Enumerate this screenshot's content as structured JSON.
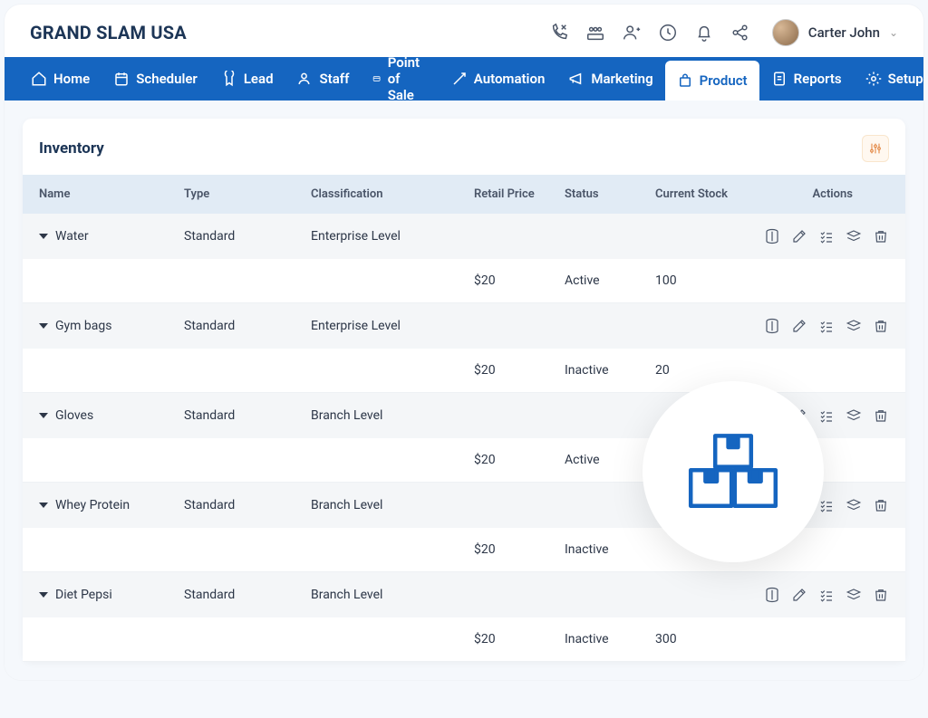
{
  "brand": "GRAND SLAM USA",
  "user": {
    "name": "Carter John"
  },
  "nav": {
    "home": {
      "label": "Home"
    },
    "scheduler": {
      "label": "Scheduler"
    },
    "lead": {
      "label": "Lead"
    },
    "staff": {
      "label": "Staff"
    },
    "pos": {
      "label": "Point of Sale"
    },
    "automation": {
      "label": "Automation"
    },
    "marketing": {
      "label": "Marketing"
    },
    "product": {
      "label": "Product"
    },
    "reports": {
      "label": "Reports"
    },
    "setup": {
      "label": "Setup"
    }
  },
  "card": {
    "title": "Inventory",
    "columns": {
      "name": "Name",
      "type": "Type",
      "classification": "Classification",
      "retail": "Retail Price",
      "status": "Status",
      "stock": "Current Stock",
      "actions": "Actions"
    },
    "rows": [
      {
        "name": "Water",
        "type": "Standard",
        "classification": "Enterprise Level",
        "retail": "$20",
        "status": "Active",
        "stock": "100"
      },
      {
        "name": "Gym bags",
        "type": "Standard",
        "classification": "Enterprise Level",
        "retail": "$20",
        "status": "Inactive",
        "stock": "20"
      },
      {
        "name": "Gloves",
        "type": "Standard",
        "classification": "Branch Level",
        "retail": "$20",
        "status": "Active",
        "stock": ""
      },
      {
        "name": "Whey Protein",
        "type": "Standard",
        "classification": "Branch Level",
        "retail": "$20",
        "status": "Inactive",
        "stock": ""
      },
      {
        "name": "Diet Pepsi",
        "type": "Standard",
        "classification": "Branch Level",
        "retail": "$20",
        "status": "Inactive",
        "stock": "300"
      }
    ]
  }
}
